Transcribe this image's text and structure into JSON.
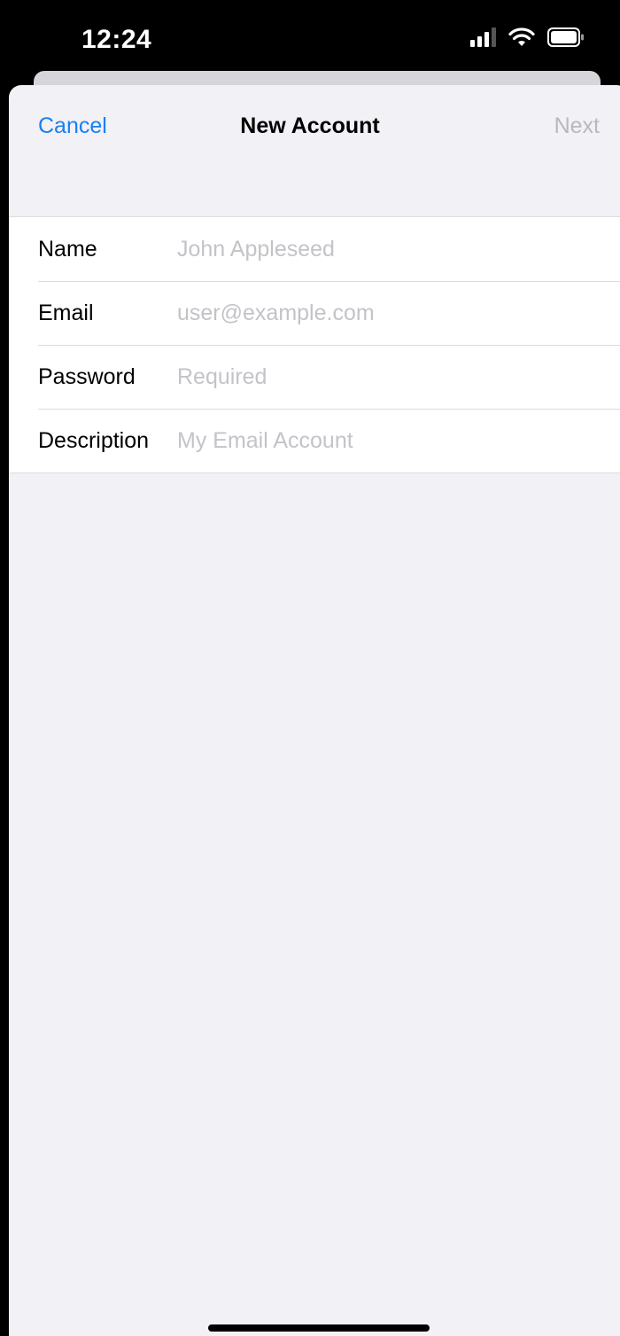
{
  "status_bar": {
    "time": "12:24",
    "icons": [
      "cellular-signal-icon",
      "wifi-icon",
      "battery-icon"
    ]
  },
  "nav": {
    "cancel_label": "Cancel",
    "title": "New Account",
    "next_label": "Next"
  },
  "form": {
    "fields": [
      {
        "label": "Name",
        "value": "",
        "placeholder": "John Appleseed"
      },
      {
        "label": "Email",
        "value": "",
        "placeholder": "user@example.com"
      },
      {
        "label": "Password",
        "value": "",
        "placeholder": "Required"
      },
      {
        "label": "Description",
        "value": "",
        "placeholder": "My Email Account"
      }
    ]
  },
  "colors": {
    "accent": "#1a7ff0",
    "disabled": "#b8b8bd",
    "placeholder": "#c3c3c8",
    "sheet_background": "#f1f1f6"
  }
}
